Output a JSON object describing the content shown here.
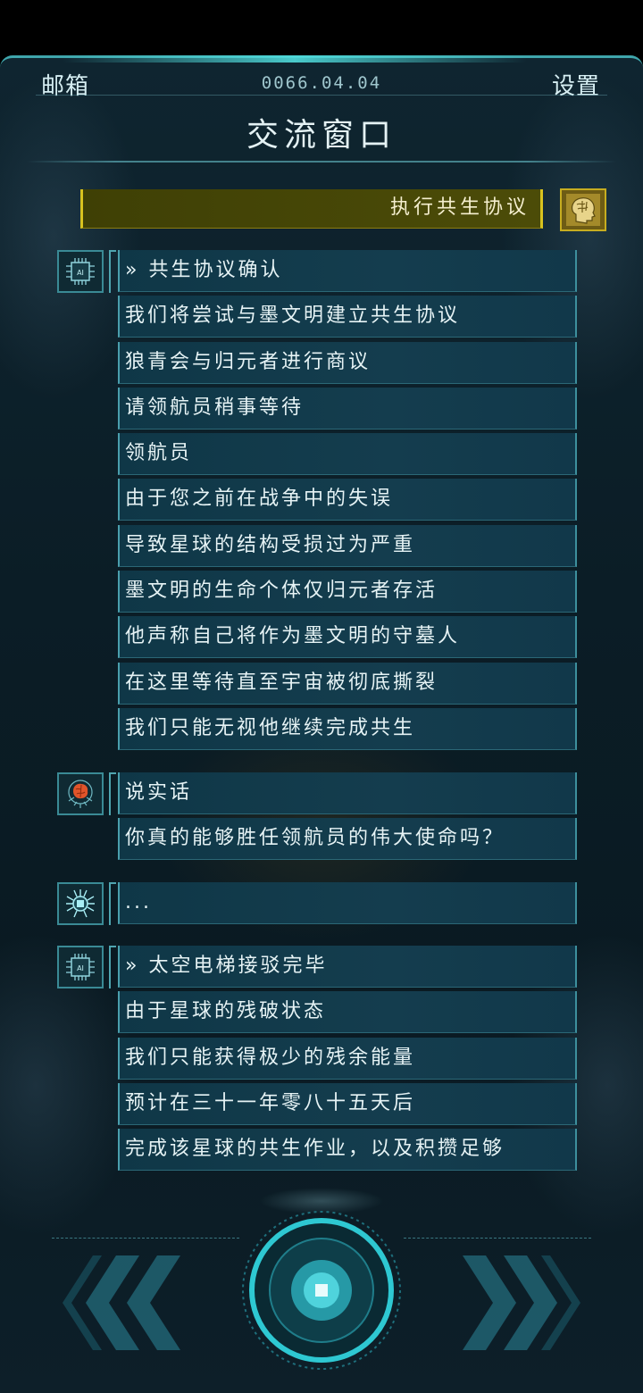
{
  "header": {
    "mailbox_label": "邮箱",
    "date": "0066.04.04",
    "settings_label": "设置",
    "title": "交流窗口"
  },
  "action": {
    "label": "执行共生协议",
    "icon": "brain-head-icon"
  },
  "colors": {
    "accent": "#3fa6ac",
    "action_border": "#d8c21e",
    "message_bg": "#143d4e"
  },
  "messages": [
    {
      "avatar": "ai-chip-icon",
      "lines": [
        "» 共生协议确认",
        "我们将尝试与墨文明建立共生协议",
        "狼青会与归元者进行商议",
        "请领航员稍事等待",
        "领航员",
        "由于您之前在战争中的失误",
        "导致星球的结构受损过为严重",
        "墨文明的生命个体仅归元者存活",
        "他声称自己将作为墨文明的守墓人",
        "在这里等待直至宇宙被彻底撕裂",
        "我们只能无视他继续完成共生"
      ]
    },
    {
      "avatar": "orange-brain-icon",
      "lines": [
        "说实话",
        "你真的能够胜任领航员的伟大使命吗？"
      ]
    },
    {
      "avatar": "cpu-spider-icon",
      "lines": [
        "..."
      ]
    },
    {
      "avatar": "ai-chip-icon",
      "lines": [
        "» 太空电梯接驳完毕",
        "由于星球的残破状态",
        "我们只能获得极少的残余能量",
        "预计在三十一年零八十五天后",
        "完成该星球的共生作业，以及积攒足够"
      ]
    }
  ],
  "controls": {
    "prev_icon": "double-chevron-left-icon",
    "center_icon": "center-ring-button-icon",
    "next_icon": "double-chevron-right-icon"
  }
}
